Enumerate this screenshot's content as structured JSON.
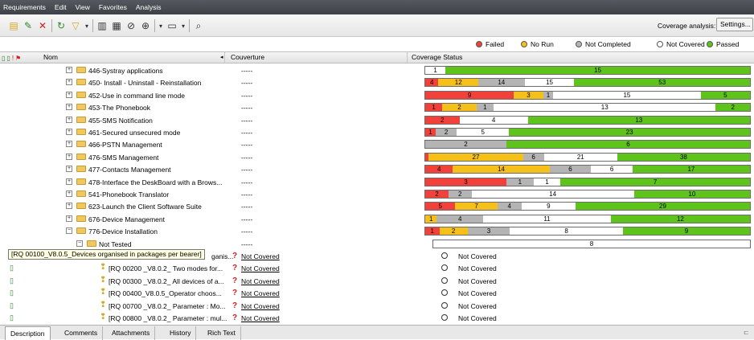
{
  "menu": [
    "Requirements",
    "Edit",
    "View",
    "Favorites",
    "Analysis"
  ],
  "toolbar_icons": [
    "add-folder-icon",
    "add-requirement-icon",
    "delete-icon",
    "refresh-icon",
    "filter-icon",
    "dropdown-icon",
    "columns-icon",
    "select-icon",
    "link-icon",
    "zoom-icon",
    "dropdown-icon",
    "view-icon",
    "dropdown-icon",
    "find-icon"
  ],
  "coverage_analysis_label": "Coverage analysis:",
  "settings_label": "Settings...",
  "legend": [
    {
      "label": "Failed",
      "color": "#f2413a"
    },
    {
      "label": "No Run",
      "color": "#f6c01b"
    },
    {
      "label": "Not Completed",
      "color": "#b4b4b4"
    },
    {
      "label": "Not Covered",
      "color": "#ffffff"
    },
    {
      "label": "Passed",
      "color": "#5ec41c"
    }
  ],
  "columns": {
    "name": "Nom",
    "coverage": "Couverture",
    "status": "Coverage Status"
  },
  "rows": [
    {
      "label": "446-Systray applications",
      "couv": "-----",
      "segs": [
        [
          "notcov",
          1
        ],
        [
          "passed",
          15
        ]
      ],
      "text": [
        "1",
        "15"
      ]
    },
    {
      "label": "450- Install - Uninstall - Reinstallation",
      "couv": "-----",
      "segs": [
        [
          "failed",
          4
        ],
        [
          "norun",
          12
        ],
        [
          "notcomp",
          14
        ],
        [
          "notcov",
          15
        ],
        [
          "passed",
          53
        ]
      ],
      "text": [
        "4",
        "12",
        "14",
        "15",
        "53"
      ]
    },
    {
      "label": "452-Use in command line mode",
      "couv": "-----",
      "segs": [
        [
          "failed",
          9
        ],
        [
          "norun",
          3
        ],
        [
          "notcomp",
          1
        ],
        [
          "notcov",
          15
        ],
        [
          "passed",
          5
        ]
      ],
      "text": [
        "9",
        "3",
        "1",
        "15",
        "5"
      ]
    },
    {
      "label": "453-The Phonebook",
      "couv": "-----",
      "segs": [
        [
          "failed",
          1
        ],
        [
          "norun",
          2
        ],
        [
          "notcomp",
          1
        ],
        [
          "notcov",
          13
        ],
        [
          "passed",
          2
        ]
      ],
      "text": [
        "1",
        "2",
        "1",
        "13",
        "2"
      ]
    },
    {
      "label": "455-SMS Notification",
      "couv": "-----",
      "segs": [
        [
          "failed",
          2
        ],
        [
          "notcov",
          4
        ],
        [
          "passed",
          13
        ]
      ],
      "text": [
        "2",
        "4",
        "13"
      ]
    },
    {
      "label": "461-Secured unsecured mode",
      "couv": "-----",
      "segs": [
        [
          "failed",
          1
        ],
        [
          "notcomp",
          2
        ],
        [
          "notcov",
          5
        ],
        [
          "passed",
          23
        ]
      ],
      "text": [
        "1",
        "2",
        "5",
        "23"
      ]
    },
    {
      "label": "466-PSTN Management",
      "couv": "-----",
      "segs": [
        [
          "notcomp",
          2
        ],
        [
          "passed",
          6
        ]
      ],
      "text": [
        "2",
        "6"
      ]
    },
    {
      "label": "476-SMS Management",
      "couv": "-----",
      "segs": [
        [
          "failed",
          1
        ],
        [
          "norun",
          27
        ],
        [
          "notcomp",
          6
        ],
        [
          "notcov",
          21
        ],
        [
          "passed",
          38
        ]
      ],
      "text": [
        "",
        "27",
        "6",
        "21",
        "38"
      ]
    },
    {
      "label": "477-Contacts Management",
      "couv": "-----",
      "segs": [
        [
          "failed",
          4
        ],
        [
          "norun",
          14
        ],
        [
          "notcomp",
          6
        ],
        [
          "notcov",
          6
        ],
        [
          "passed",
          17
        ]
      ],
      "text": [
        "4",
        "14",
        "6",
        "6",
        "17"
      ]
    },
    {
      "label": "478-Interface the DeskBoard with a Brows...",
      "couv": "-----",
      "segs": [
        [
          "failed",
          3
        ],
        [
          "notcomp",
          1
        ],
        [
          "notcov",
          1
        ],
        [
          "passed",
          7
        ]
      ],
      "text": [
        "3",
        "1",
        "1",
        "7"
      ]
    },
    {
      "label": "541-Phonebook Translator",
      "couv": "-----",
      "segs": [
        [
          "failed",
          2
        ],
        [
          "notcomp",
          2
        ],
        [
          "notcov",
          14
        ],
        [
          "passed",
          10
        ]
      ],
      "text": [
        "2",
        "2",
        "14",
        "10"
      ]
    },
    {
      "label": "623-Launch the Client Software Suite",
      "couv": "-----",
      "segs": [
        [
          "failed",
          5
        ],
        [
          "norun",
          7
        ],
        [
          "notcomp",
          4
        ],
        [
          "notcov",
          9
        ],
        [
          "passed",
          29
        ]
      ],
      "text": [
        "5",
        "7",
        "4",
        "9",
        "29"
      ]
    },
    {
      "label": "676-Device Management",
      "couv": "-----",
      "segs": [
        [
          "norun",
          1
        ],
        [
          "notcomp",
          4
        ],
        [
          "notcov",
          11
        ],
        [
          "passed",
          12
        ]
      ],
      "text": [
        "1",
        "4",
        "11",
        "12"
      ]
    },
    {
      "label": "776-Device Installation",
      "couv": "-----",
      "segs": [
        [
          "failed",
          1
        ],
        [
          "norun",
          2
        ],
        [
          "notcomp",
          3
        ],
        [
          "notcov",
          8
        ],
        [
          "passed",
          9
        ]
      ],
      "text": [
        "1",
        "2",
        "3",
        "8",
        "9"
      ]
    }
  ],
  "not_tested": {
    "label": "Not Tested",
    "couv": "-----",
    "segs": [
      [
        "notcov",
        8
      ]
    ],
    "text": [
      "8"
    ]
  },
  "requirements": [
    {
      "label": "ganis...",
      "status": "Not Covered",
      "cov": "Not Covered"
    },
    {
      "label": "[RQ 00200 _V8.0.2_ Two modes for...",
      "status": "Not Covered",
      "cov": "Not Covered"
    },
    {
      "label": "[RQ 00300 _V8.0.2_ All devices of a...",
      "status": "Not Covered",
      "cov": "Not Covered"
    },
    {
      "label": "[RQ 00400_V8.0.5_Operator choos...",
      "status": "Not Covered",
      "cov": "Not Covered"
    },
    {
      "label": "[RQ 00700 _V8.0.2_ Parameter : Mo...",
      "status": "Not Covered",
      "cov": "Not Covered"
    },
    {
      "label": "[RQ 00800 _V8.0.2_ Parameter : mul...",
      "status": "Not Covered",
      "cov": "Not Covered"
    }
  ],
  "tooltip": "[RQ 00100_V8.0.5_Devices organised in packages per bearer]",
  "tabs": [
    "Description",
    "Comments",
    "Attachments",
    "History",
    "Rich Text"
  ]
}
